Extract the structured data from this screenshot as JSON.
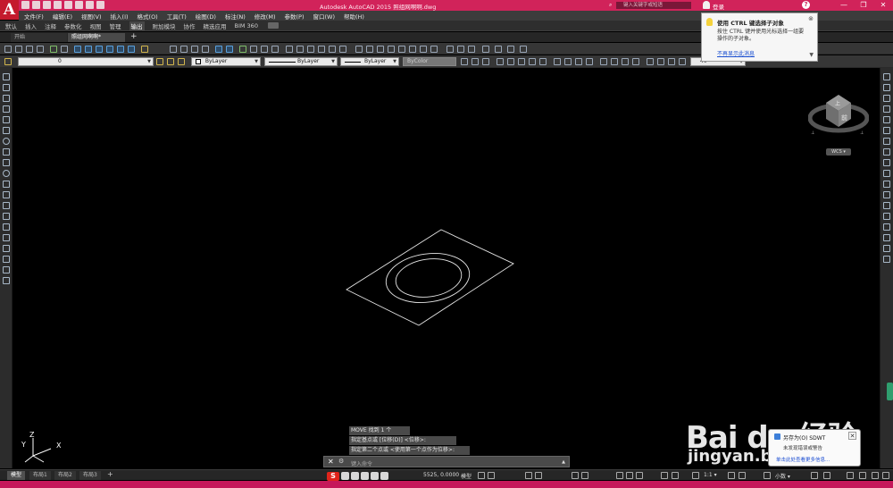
{
  "window": {
    "title": "Autodesk AutoCAD 2015    照组网啊啊.dwg",
    "search_placeholder": "键入关键字或短语",
    "login": "登录",
    "controls": [
      "—",
      "❐",
      "✕"
    ]
  },
  "menu": [
    "文件(F)",
    "编辑(E)",
    "视图(V)",
    "插入(I)",
    "格式(O)",
    "工具(T)",
    "绘图(D)",
    "标注(N)",
    "修改(M)",
    "参数(P)",
    "窗口(W)",
    "帮助(H)"
  ],
  "ribbon_tabs": [
    "默认",
    "插入",
    "注释",
    "参数化",
    "视图",
    "管理",
    "输出",
    "附加模块",
    "协作",
    "精选应用",
    "BIM 360"
  ],
  "ribbon_active_tab": "输出",
  "file_tabs": {
    "start": "开始",
    "drawing": "照组网啊啊*"
  },
  "toolbar2": {
    "layer": "0",
    "color": "ByLayer",
    "linetype": "ByLayer",
    "lineweight": "ByLayer",
    "plotstyle": "ByColor",
    "dim_value": "40"
  },
  "notification": {
    "title": "使用 CTRL 键选择子对象",
    "body": "按住 CTRL 键并使用光标选择一组要操作的子对象。",
    "link": "不再显示此消息"
  },
  "viewcube": {
    "face_top": "上",
    "face_front": "前",
    "wcs": "WCS ▾"
  },
  "ucs": {
    "x": "X",
    "y": "Y",
    "z": "Z"
  },
  "command": {
    "history": [
      "MOVE 找到 1 个",
      "指定基点或 [位移(D)] <位移>:",
      "指定第二个点或 <使用第一个点作为位移>:"
    ],
    "prompt": "键入命令",
    "close": "✕"
  },
  "status": {
    "layout_tabs": [
      "模型",
      "布局1",
      "布局2",
      "布局3"
    ],
    "coords": "5525, 0.0000",
    "model": "模型",
    "scale": "1:1 ▾",
    "units": "小数 ▾"
  },
  "balloon": {
    "title": "另存为(O)   SDWT",
    "text": "未发现错误或警告",
    "link": "单击此处查看更多信息..."
  },
  "ime": {
    "logo": "S"
  },
  "watermark": {
    "brand": "Bai du 经验",
    "site": "jingyan.baidu.com"
  },
  "colors": {
    "titlebar": "#d1235a",
    "canvas": "#000000",
    "ui_dark": "#2c2c2c"
  }
}
